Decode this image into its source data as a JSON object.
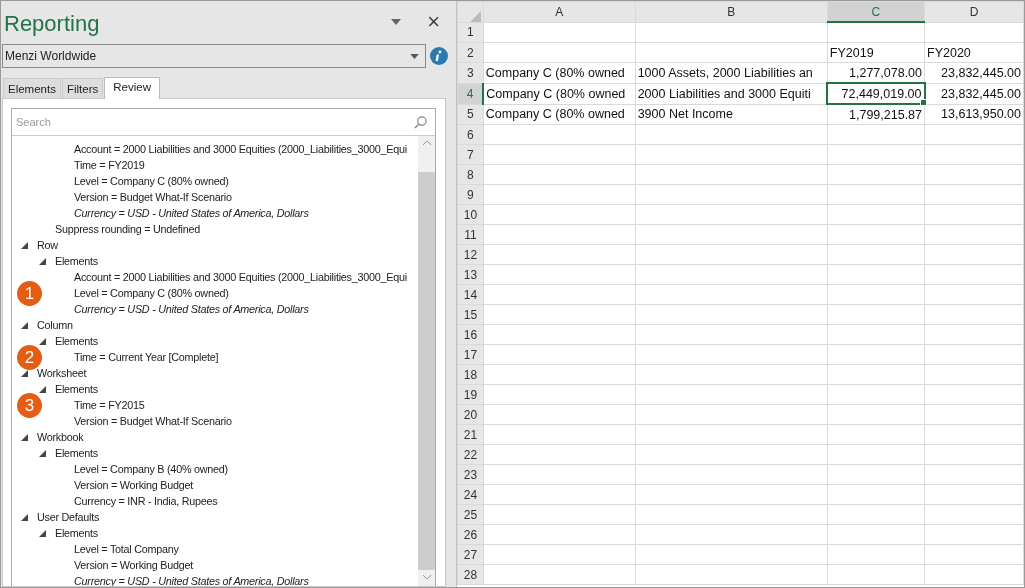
{
  "panel": {
    "title": "Reporting",
    "close_label": "×",
    "connection": {
      "value": "Menzi Worldwide"
    },
    "tabs": [
      {
        "label": "Elements",
        "selected": false
      },
      {
        "label": "Filters",
        "selected": false
      },
      {
        "label": "Review",
        "selected": true
      }
    ],
    "search": {
      "placeholder": "Search"
    },
    "tree": [
      {
        "children": [
          {
            "children": [
              {
                "label": "Account = 2000 Liabilities and 3000 Equities (2000_Liabilities_3000_Equi",
                "italic": false
              },
              {
                "label": "Time = FY2019",
                "italic": false
              },
              {
                "label": "Level = Company C (80% owned)",
                "italic": false
              },
              {
                "label": "Version = Budget What-If Scenario",
                "italic": false
              },
              {
                "label": "Currency = USD - United States of America, Dollars",
                "italic": true
              }
            ]
          },
          {
            "label": "Suppress rounding = Undefined",
            "italic": false
          }
        ]
      },
      {
        "label": "Row",
        "expanded": true,
        "children": [
          {
            "label": "Elements",
            "expanded": true,
            "children": [
              {
                "label": "Account = 2000 Liabilities and 3000 Equities (2000_Liabilities_3000_Equi",
                "italic": false
              },
              {
                "label": "Level = Company C (80% owned)",
                "italic": false,
                "callout": "1"
              },
              {
                "label": "Currency = USD - United States of America, Dollars",
                "italic": true
              }
            ]
          }
        ]
      },
      {
        "label": "Column",
        "expanded": true,
        "children": [
          {
            "label": "Elements",
            "expanded": true,
            "children": [
              {
                "label": "Time = Current Year [Complete]",
                "italic": false,
                "callout": "2"
              }
            ]
          }
        ]
      },
      {
        "label": "Worksheet",
        "expanded": true,
        "children": [
          {
            "label": "Elements",
            "expanded": true,
            "children": [
              {
                "label": "Time = FY2015",
                "italic": false,
                "callout": "3"
              },
              {
                "label": "Version = Budget What-If Scenario",
                "italic": false
              }
            ]
          }
        ]
      },
      {
        "label": "Workbook",
        "expanded": true,
        "children": [
          {
            "label": "Elements",
            "expanded": true,
            "children": [
              {
                "label": "Level = Company B (40% owned)",
                "italic": false
              },
              {
                "label": "Version = Working Budget",
                "italic": false
              },
              {
                "label": "Currency = INR - India, Rupees",
                "italic": false
              }
            ]
          }
        ]
      },
      {
        "label": "User Defaults",
        "expanded": true,
        "children": [
          {
            "label": "Elements",
            "expanded": true,
            "children": [
              {
                "label": "Level = Total Company",
                "italic": false
              },
              {
                "label": "Version = Working Budget",
                "italic": false
              },
              {
                "label": "Currency = USD - United States of America, Dollars",
                "italic": true
              }
            ]
          }
        ]
      }
    ]
  },
  "sheet": {
    "columns": [
      {
        "label": "A",
        "selected": false
      },
      {
        "label": "B",
        "selected": false
      },
      {
        "label": "C",
        "selected": true
      },
      {
        "label": "D",
        "selected": false
      }
    ],
    "rows": [
      {
        "number": "1",
        "selected": false
      },
      {
        "number": "2",
        "selected": false,
        "cells": [
          null,
          null,
          {
            "text": "FY2019",
            "kind": "text",
            "selected": false
          },
          {
            "text": "FY2020",
            "kind": "text",
            "selected": false
          }
        ]
      },
      {
        "number": "3",
        "selected": false,
        "cells": [
          {
            "text": "Company C (80% owned",
            "kind": "text",
            "selected": false
          },
          {
            "text": "1000 Assets, 2000 Liabilities an",
            "kind": "text",
            "selected": false
          },
          {
            "text": "1,277,078.00",
            "kind": "number",
            "selected": false
          },
          {
            "text": "23,832,445.00",
            "kind": "number",
            "selected": false
          }
        ]
      },
      {
        "number": "4",
        "selected": true,
        "cells": [
          {
            "text": "Company C (80% owned",
            "kind": "text",
            "selected": false
          },
          {
            "text": "2000 Liabilities and 3000 Equiti",
            "kind": "text",
            "selected": false
          },
          {
            "text": "72,449,019.00",
            "kind": "number",
            "selected": true
          },
          {
            "text": "23,832,445.00",
            "kind": "number",
            "selected": false
          }
        ]
      },
      {
        "number": "5",
        "selected": false,
        "cells": [
          {
            "text": "Company C (80% owned",
            "kind": "text",
            "selected": false
          },
          {
            "text": "3900 Net Income",
            "kind": "text",
            "selected": false
          },
          {
            "text": "1,799,215.87",
            "kind": "number",
            "selected": false
          },
          {
            "text": "13,613,950.00",
            "kind": "number",
            "selected": false
          }
        ]
      },
      {
        "number": "6",
        "selected": false
      },
      {
        "number": "7",
        "selected": false
      },
      {
        "number": "8",
        "selected": false
      },
      {
        "number": "9",
        "selected": false
      },
      {
        "number": "10",
        "selected": false
      },
      {
        "number": "11",
        "selected": false
      },
      {
        "number": "12",
        "selected": false
      },
      {
        "number": "13",
        "selected": false
      },
      {
        "number": "14",
        "selected": false
      },
      {
        "number": "15",
        "selected": false
      },
      {
        "number": "16",
        "selected": false
      },
      {
        "number": "17",
        "selected": false
      },
      {
        "number": "18",
        "selected": false
      },
      {
        "number": "19",
        "selected": false
      },
      {
        "number": "20",
        "selected": false
      },
      {
        "number": "21",
        "selected": false
      },
      {
        "number": "22",
        "selected": false
      },
      {
        "number": "23",
        "selected": false
      },
      {
        "number": "24",
        "selected": false
      },
      {
        "number": "25",
        "selected": false
      },
      {
        "number": "26",
        "selected": false
      },
      {
        "number": "27",
        "selected": false
      },
      {
        "number": "28",
        "selected": false
      }
    ]
  }
}
